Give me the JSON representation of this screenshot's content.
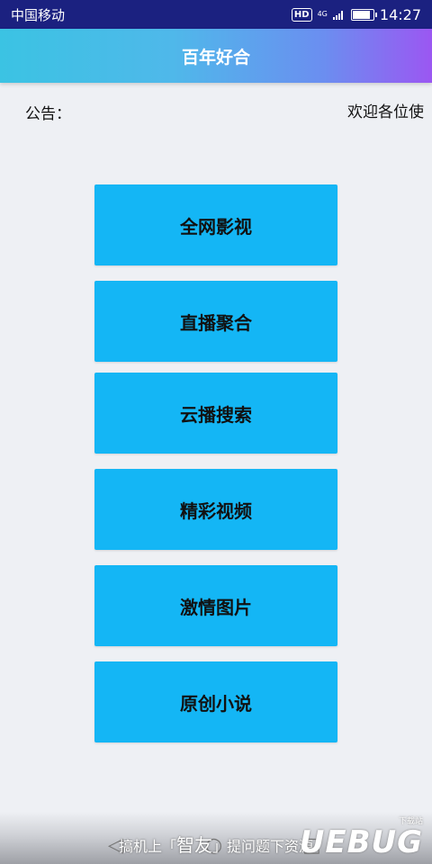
{
  "status_bar": {
    "carrier": "中国移动",
    "hd": "HD",
    "network": "4G",
    "time": "14:27",
    "battery_level": 0.85
  },
  "app_bar": {
    "title": "百年好合"
  },
  "notice": {
    "label": "公告：",
    "text": "欢迎各位使"
  },
  "menu": [
    {
      "label": "全网影视"
    },
    {
      "label": "直播聚合"
    },
    {
      "label": "云播搜索"
    },
    {
      "label": "精彩视频"
    },
    {
      "label": "激情图片"
    },
    {
      "label": "原创小说"
    }
  ],
  "watermark": {
    "prefix": "搞机上「",
    "brand": "智友",
    "suffix": "」提问题下资源",
    "logo": "UEBUG",
    "logo_sub": "下载站"
  },
  "colors": {
    "status_bar": "#1b2180",
    "button": "#14b6f5",
    "background": "#eef0f4"
  }
}
